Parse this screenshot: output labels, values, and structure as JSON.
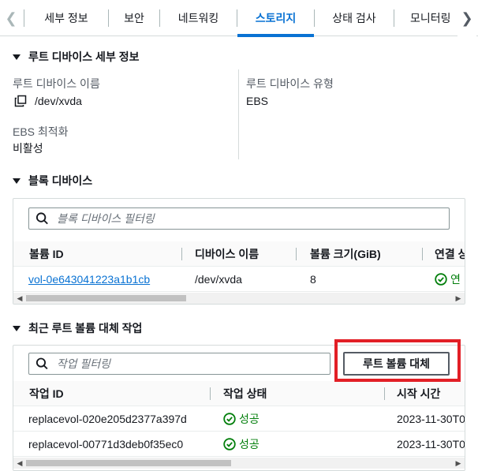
{
  "tabs": [
    {
      "label": "세부 정보",
      "active": false
    },
    {
      "label": "보안",
      "active": false
    },
    {
      "label": "네트워킹",
      "active": false
    },
    {
      "label": "스토리지",
      "active": true
    },
    {
      "label": "상태 검사",
      "active": false
    },
    {
      "label": "모니터링",
      "active": false
    }
  ],
  "root_device": {
    "header": "루트 디바이스 세부 정보",
    "name_label": "루트 디바이스 이름",
    "name_value": "/dev/xvda",
    "type_label": "루트 디바이스 유형",
    "type_value": "EBS",
    "ebs_opt_label": "EBS 최적화",
    "ebs_opt_value": "비활성"
  },
  "block_devices": {
    "header": "블록 디바이스",
    "filter_placeholder": "블록 디바이스 필터링",
    "columns": [
      "볼륨 ID",
      "디바이스 이름",
      "볼륨 크기(GiB)",
      "연결 상"
    ],
    "rows": [
      {
        "volume_id": "vol-0e643041223a1b1cb",
        "device_name": "/dev/xvda",
        "size": "8",
        "status": "연"
      }
    ]
  },
  "replace_tasks": {
    "header": "최근 루트 볼륨 대체 작업",
    "filter_placeholder": "작업 필터링",
    "replace_button": "루트 볼륨 대체",
    "columns": [
      "작업 ID",
      "작업 상태",
      "시작 시간"
    ],
    "rows": [
      {
        "task_id": "replacevol-020e205d2377a397d",
        "status": "성공",
        "start": "2023-11-30T0"
      },
      {
        "task_id": "replacevol-00771d3deb0f35ec0",
        "status": "성공",
        "start": "2023-11-30T0"
      }
    ]
  },
  "colors": {
    "accent": "#0972d3",
    "success": "#037f0c",
    "highlight": "#e21f26"
  }
}
